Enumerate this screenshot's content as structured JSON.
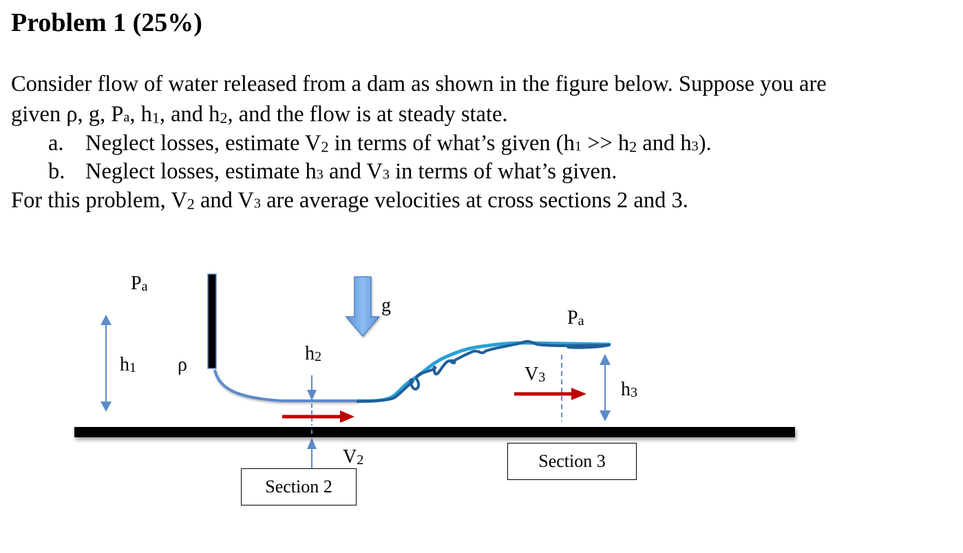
{
  "document": {
    "title": "Problem 1 (25%)",
    "intro_line1": "Consider flow of water released from a dam as shown in the figure below.  Suppose you are",
    "intro_line2": {
      "p1": "given ρ, g, P",
      "p1_sub": "a",
      "p2": ",  h",
      "p2_sub": "1",
      "p3": ", and h",
      "p3_sub": "2",
      "p4": ", and the flow is at steady state."
    },
    "items": [
      {
        "marker": "a.",
        "p1": "Neglect losses, estimate V",
        "p1_sub": "2",
        "p2": " in terms of what’s given (h",
        "p2_sub": "1",
        "p3": " >>  h",
        "p3_sub": "2",
        "p4": " and h",
        "p4_sub": "3",
        "p5": ")."
      },
      {
        "marker": "b.",
        "p1": "Neglect losses, estimate h",
        "p1_sub": "3",
        "p2": " and V",
        "p2_sub": "3",
        "p3": " in terms of what’s given."
      }
    ],
    "closing": {
      "p1": "For this problem, V",
      "p1_sub": "2",
      "p2": " and V",
      "p2_sub": "3",
      "p3": " are average velocities at cross sections 2 and 3."
    }
  },
  "figure": {
    "labels": {
      "pa_left": {
        "main": "P",
        "sub": "a"
      },
      "h1": {
        "main": "h",
        "sub": "1"
      },
      "rho": "ρ",
      "h2": {
        "main": "h",
        "sub": "2"
      },
      "g": "g",
      "pa_right": {
        "main": "P",
        "sub": "a"
      },
      "v3": {
        "main": "V",
        "sub": "3"
      },
      "h3": {
        "main": "h",
        "sub": "3"
      },
      "v2": {
        "main": "V",
        "sub": "2"
      }
    },
    "section2": "Section 2",
    "section3": "Section 3",
    "colors": {
      "water_line": "#5b8bc9",
      "dam_wall": "#000000",
      "ground": "#000000",
      "velocity_arrow": "#c00000",
      "gravity_arrow": "#7aaee8",
      "turbulent_dark": "#1f5f99",
      "turbulent_light": "#2aa0d8"
    }
  }
}
